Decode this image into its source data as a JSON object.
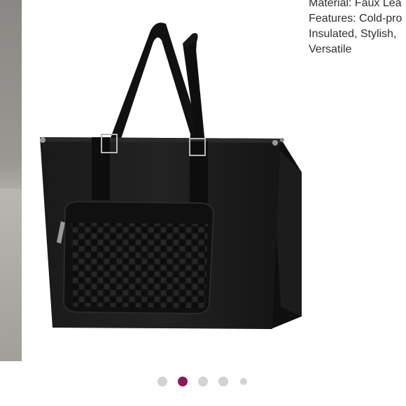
{
  "product": {
    "image_alt": "black tote bag with woven front pocket",
    "specs": [
      "Material: Faux Lea",
      "Features: Cold-pro",
      "Insulated, Stylish,",
      "Versatile"
    ]
  },
  "carousel": {
    "total": 5,
    "active_index": 1,
    "active_color": "#8b1a5e",
    "inactive_color": "#d3d3d3"
  }
}
